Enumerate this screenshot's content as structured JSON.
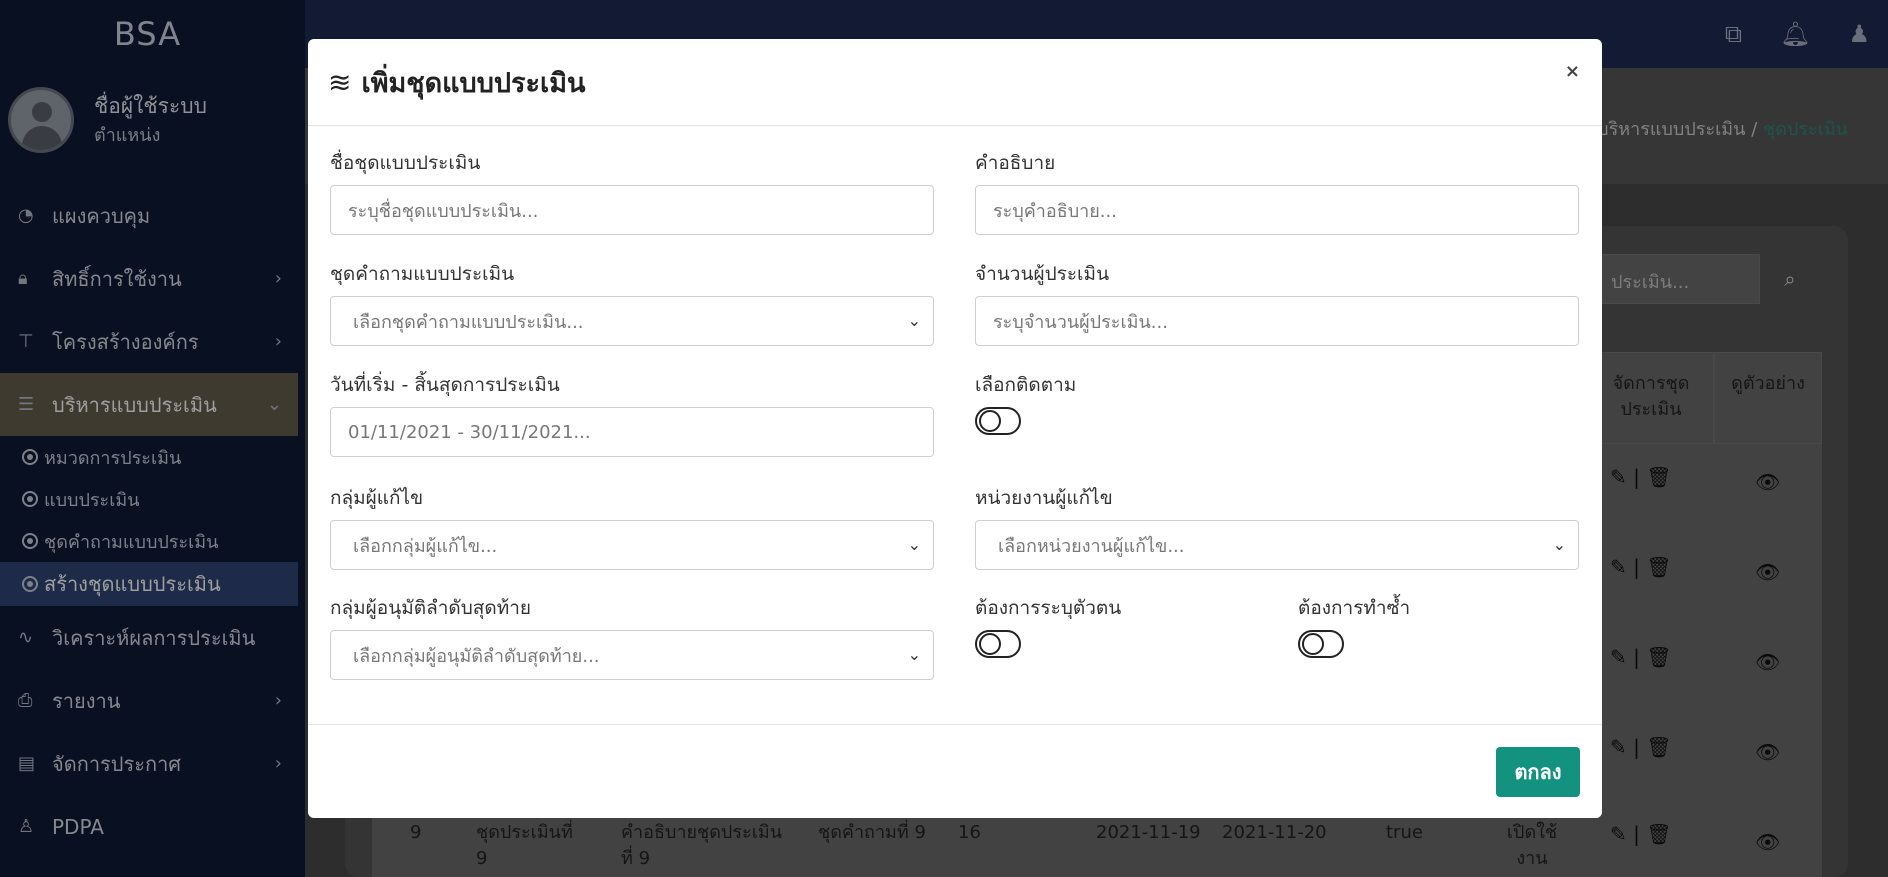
{
  "sidebar": {
    "brand": "BSA",
    "user": {
      "name": "ชื่อผู้ใช้ระบบ",
      "role": "ตำแหน่ง"
    },
    "items": [
      {
        "label": "แผงควบคุม",
        "icon": "dashboard-icon",
        "glyph": "◔"
      },
      {
        "label": "สิทธิ์การใช้งาน",
        "icon": "lock-icon",
        "glyph": "🔒︎"
      },
      {
        "label": "โครงสร้างองค์กร",
        "icon": "sitemap-icon",
        "glyph": "⊤"
      },
      {
        "label": "บริหารแบบประเมิน",
        "icon": "list-icon",
        "glyph": "☰"
      },
      {
        "label": "วิเคราะห์ผลการประเมิน",
        "icon": "pulse-icon",
        "glyph": "∿"
      },
      {
        "label": "รายงาน",
        "icon": "print-icon",
        "glyph": "⎙"
      },
      {
        "label": "จัดการประกาศ",
        "icon": "newspaper-icon",
        "glyph": "▤"
      },
      {
        "label": "PDPA",
        "icon": "user-lock-icon",
        "glyph": "♙"
      }
    ],
    "subitems": [
      "หมวดการประเมิน",
      "แบบประเมิน",
      "ชุดคำถามแบบประเมิน",
      "สร้างชุดแบบประเมิน"
    ]
  },
  "breadcrumb": {
    "parent": "บริหารแบบประเมิน",
    "sep": "/",
    "current": "ชุดประเมิน"
  },
  "background": {
    "search_placeholder": "ประเมิน...",
    "col_manage": "จัดการชุดประเมิน",
    "col_preview": "ดูตัวอย่าง",
    "last_row": {
      "no": "9",
      "name": "ชุดประเมินที่ 9",
      "desc": "คำอธิบายชุดประเมินที่ 9",
      "qset": "ชุดคำถามที่ 9",
      "count": "16",
      "start": "2021-11-19",
      "end": "2021-11-20",
      "flag": "true",
      "status": "เปิดใช้งาน"
    }
  },
  "modal": {
    "title": "เพิ่มชุดแบบประเมิน",
    "close": "×",
    "fields": {
      "name": {
        "label": "ชื่อชุดแบบประเมิน",
        "placeholder": "ระบุชื่อชุดแบบประเมิน..."
      },
      "desc": {
        "label": "คำอธิบาย",
        "placeholder": "ระบุคำอธิบาย..."
      },
      "qset": {
        "label": "ชุดคำถามแบบประเมิน",
        "value": "เลือกชุดคำถามแบบประเมิน..."
      },
      "count": {
        "label": "จำนวนผู้ประเมิน",
        "placeholder": "ระบุจำนวนผู้ประเมิน..."
      },
      "daterange": {
        "label": "วันที่เริ่ม - สิ้นสุดการประเมิน",
        "placeholder": "01/11/2021 - 30/11/2021..."
      },
      "follow": {
        "label": "เลือกติดตาม"
      },
      "editor_group": {
        "label": "กลุ่มผู้แก้ไข",
        "value": "เลือกกลุ่มผู้แก้ไข..."
      },
      "editor_unit": {
        "label": "หน่วยงานผู้แก้ไข",
        "value": "เลือกหน่วยงานผู้แก้ไข..."
      },
      "approver": {
        "label": "กลุ่มผู้อนุมัติลำดับสุดท้าย",
        "value": "เลือกกลุ่มผู้อนุมัติลำดับสุดท้าย..."
      },
      "identify": {
        "label": "ต้องการระบุตัวตน"
      },
      "repeat": {
        "label": "ต้องการทำซ้ำ"
      }
    },
    "ok": "ตกลง"
  }
}
